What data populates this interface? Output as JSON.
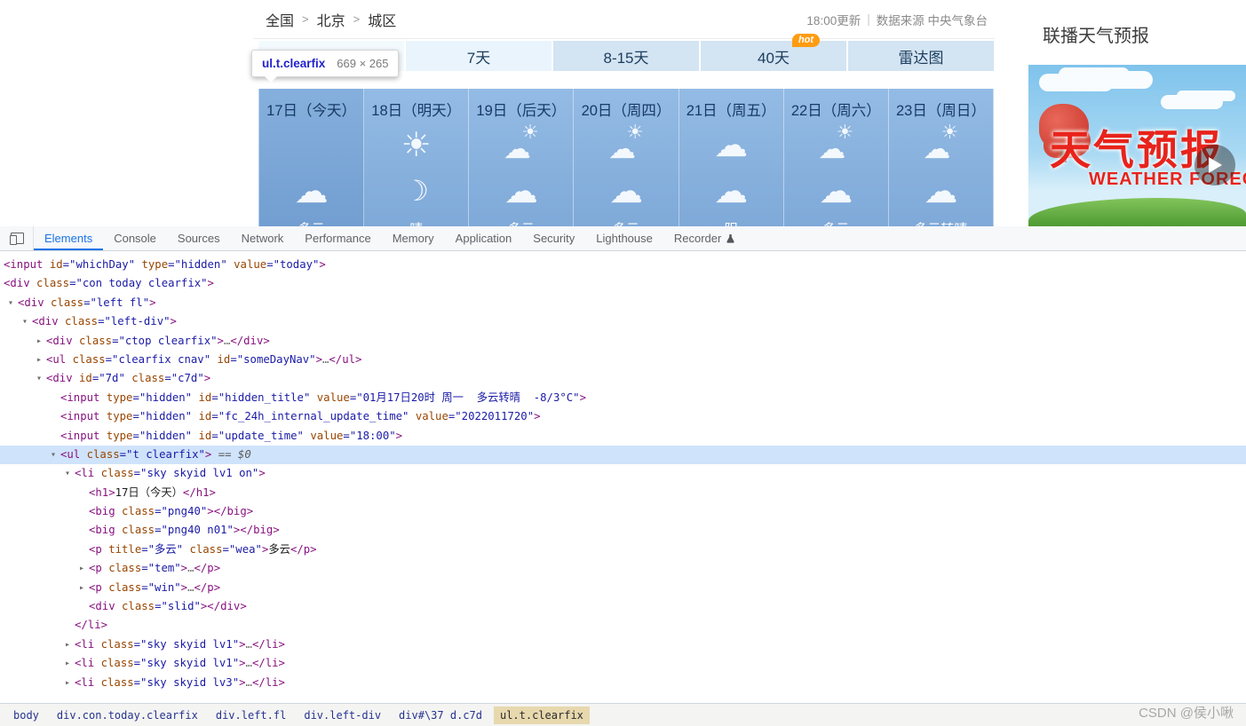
{
  "weather": {
    "site_breadcrumb": [
      "全国",
      "北京",
      "城区"
    ],
    "separator": ">",
    "update_time": "18:00更新",
    "divider": "|",
    "source": "数据来源 中央气象台",
    "tabs": [
      {
        "label": "7天",
        "variant": "light"
      },
      {
        "label": "8-15天"
      },
      {
        "label": "40天",
        "badge": "hot"
      },
      {
        "label": "雷达图"
      }
    ],
    "days": [
      {
        "title": "17日（今天）",
        "icons": [
          null,
          "cloud"
        ],
        "wea": "多云"
      },
      {
        "title": "18日（明天）",
        "icons": [
          "sun",
          "moon"
        ],
        "wea": "晴"
      },
      {
        "title": "19日（后天）",
        "icons": [
          "sun-cloud",
          "cloud"
        ],
        "wea": "多云"
      },
      {
        "title": "20日（周四）",
        "icons": [
          "sun-cloud",
          "cloud"
        ],
        "wea": "多云"
      },
      {
        "title": "21日（周五）",
        "icons": [
          "cloud",
          "cloud"
        ],
        "wea": "阴"
      },
      {
        "title": "22日（周六）",
        "icons": [
          "sun-cloud",
          "cloud"
        ],
        "wea": "多云"
      },
      {
        "title": "23日（周日）",
        "icons": [
          "sun-cloud",
          "cloud"
        ],
        "wea": "多云转晴"
      }
    ]
  },
  "inspect_tooltip": {
    "selector": "ul.t.clearfix",
    "dimensions": "669 × 265"
  },
  "video_panel": {
    "title": "联播天气预报",
    "overlay_title_cn": "天气预报",
    "overlay_title_en": "WEATHER FOREC"
  },
  "devtools": {
    "tabs": [
      {
        "label": "Elements",
        "active": true
      },
      {
        "label": "Console"
      },
      {
        "label": "Sources"
      },
      {
        "label": "Network"
      },
      {
        "label": "Performance"
      },
      {
        "label": "Memory"
      },
      {
        "label": "Application"
      },
      {
        "label": "Security"
      },
      {
        "label": "Lighthouse"
      },
      {
        "label": "Recorder",
        "icon": "flask"
      }
    ],
    "tree": [
      {
        "i": 0,
        "tok": [
          [
            "tag",
            "<input"
          ],
          [
            "pln",
            " "
          ],
          [
            "attr",
            "id"
          ],
          [
            "val",
            "=\"whichDay\""
          ],
          [
            "pln",
            " "
          ],
          [
            "attr",
            "type"
          ],
          [
            "val",
            "=\"hidden\""
          ],
          [
            "pln",
            " "
          ],
          [
            "attr",
            "value"
          ],
          [
            "val",
            "=\"today\""
          ],
          [
            "tag",
            ">"
          ]
        ]
      },
      {
        "i": 0,
        "tok": [
          [
            "tag",
            "<div"
          ],
          [
            "pln",
            " "
          ],
          [
            "attr",
            "class"
          ],
          [
            "val",
            "=\"con today clearfix\""
          ],
          [
            "tag",
            ">"
          ]
        ]
      },
      {
        "i": 1,
        "a": "d",
        "tok": [
          [
            "tag",
            "<div"
          ],
          [
            "pln",
            " "
          ],
          [
            "attr",
            "class"
          ],
          [
            "val",
            "=\"left fl\""
          ],
          [
            "tag",
            ">"
          ]
        ]
      },
      {
        "i": 2,
        "a": "d",
        "tok": [
          [
            "tag",
            "<div"
          ],
          [
            "pln",
            " "
          ],
          [
            "attr",
            "class"
          ],
          [
            "val",
            "=\"left-div\""
          ],
          [
            "tag",
            ">"
          ]
        ]
      },
      {
        "i": 3,
        "a": "r",
        "tok": [
          [
            "tag",
            "<div"
          ],
          [
            "pln",
            " "
          ],
          [
            "attr",
            "class"
          ],
          [
            "val",
            "=\"ctop clearfix\""
          ],
          [
            "tag",
            ">"
          ],
          [
            "dots",
            "…"
          ],
          [
            "tag",
            "</div>"
          ]
        ]
      },
      {
        "i": 3,
        "a": "r",
        "tok": [
          [
            "tag",
            "<ul"
          ],
          [
            "pln",
            " "
          ],
          [
            "attr",
            "class"
          ],
          [
            "val",
            "=\"clearfix cnav\""
          ],
          [
            "pln",
            " "
          ],
          [
            "attr",
            "id"
          ],
          [
            "val",
            "=\"someDayNav\""
          ],
          [
            "tag",
            ">"
          ],
          [
            "dots",
            "…"
          ],
          [
            "tag",
            "</ul>"
          ]
        ]
      },
      {
        "i": 3,
        "a": "d",
        "tok": [
          [
            "tag",
            "<div"
          ],
          [
            "pln",
            " "
          ],
          [
            "attr",
            "id"
          ],
          [
            "val",
            "=\"7d\""
          ],
          [
            "pln",
            " "
          ],
          [
            "attr",
            "class"
          ],
          [
            "val",
            "=\"c7d\""
          ],
          [
            "tag",
            ">"
          ]
        ]
      },
      {
        "i": 4,
        "tok": [
          [
            "tag",
            "<input"
          ],
          [
            "pln",
            " "
          ],
          [
            "attr",
            "type"
          ],
          [
            "val",
            "=\"hidden\""
          ],
          [
            "pln",
            " "
          ],
          [
            "attr",
            "id"
          ],
          [
            "val",
            "=\"hidden_title\""
          ],
          [
            "pln",
            " "
          ],
          [
            "attr",
            "value"
          ],
          [
            "val",
            "=\"01月17日20时 周一  多云转晴  -8/3°C\""
          ],
          [
            "tag",
            ">"
          ]
        ]
      },
      {
        "i": 4,
        "tok": [
          [
            "tag",
            "<input"
          ],
          [
            "pln",
            " "
          ],
          [
            "attr",
            "type"
          ],
          [
            "val",
            "=\"hidden\""
          ],
          [
            "pln",
            " "
          ],
          [
            "attr",
            "id"
          ],
          [
            "val",
            "=\"fc_24h_internal_update_time\""
          ],
          [
            "pln",
            " "
          ],
          [
            "attr",
            "value"
          ],
          [
            "val",
            "=\"2022011720\""
          ],
          [
            "tag",
            ">"
          ]
        ]
      },
      {
        "i": 4,
        "tok": [
          [
            "tag",
            "<input"
          ],
          [
            "pln",
            " "
          ],
          [
            "attr",
            "type"
          ],
          [
            "val",
            "=\"hidden\""
          ],
          [
            "pln",
            " "
          ],
          [
            "attr",
            "id"
          ],
          [
            "val",
            "=\"update_time\""
          ],
          [
            "pln",
            " "
          ],
          [
            "attr",
            "value"
          ],
          [
            "val",
            "=\"18:00\""
          ],
          [
            "tag",
            ">"
          ]
        ]
      },
      {
        "i": 4,
        "a": "d",
        "sel": true,
        "tok": [
          [
            "tag",
            "<ul"
          ],
          [
            "pln",
            " "
          ],
          [
            "attr",
            "class"
          ],
          [
            "val",
            "=\"t clearfix\""
          ],
          [
            "tag",
            ">"
          ],
          [
            "eq",
            " == $0"
          ]
        ]
      },
      {
        "i": 5,
        "a": "d",
        "tok": [
          [
            "tag",
            "<li"
          ],
          [
            "pln",
            " "
          ],
          [
            "attr",
            "class"
          ],
          [
            "val",
            "=\"sky skyid lv1 on\""
          ],
          [
            "tag",
            ">"
          ]
        ]
      },
      {
        "i": 6,
        "tok": [
          [
            "tag",
            "<h1>"
          ],
          [
            "txt",
            "17日（今天）"
          ],
          [
            "tag",
            "</h1>"
          ]
        ]
      },
      {
        "i": 6,
        "tok": [
          [
            "tag",
            "<big"
          ],
          [
            "pln",
            " "
          ],
          [
            "attr",
            "class"
          ],
          [
            "val",
            "=\"png40\""
          ],
          [
            "tag",
            ">"
          ],
          [
            "tag",
            "</big>"
          ]
        ]
      },
      {
        "i": 6,
        "tok": [
          [
            "tag",
            "<big"
          ],
          [
            "pln",
            " "
          ],
          [
            "attr",
            "class"
          ],
          [
            "val",
            "=\"png40 n01\""
          ],
          [
            "tag",
            ">"
          ],
          [
            "tag",
            "</big>"
          ]
        ]
      },
      {
        "i": 6,
        "tok": [
          [
            "tag",
            "<p"
          ],
          [
            "pln",
            " "
          ],
          [
            "attr",
            "title"
          ],
          [
            "val",
            "=\"多云\""
          ],
          [
            "pln",
            " "
          ],
          [
            "attr",
            "class"
          ],
          [
            "val",
            "=\"wea\""
          ],
          [
            "tag",
            ">"
          ],
          [
            "txt",
            "多云"
          ],
          [
            "tag",
            "</p>"
          ]
        ]
      },
      {
        "i": 6,
        "a": "r",
        "tok": [
          [
            "tag",
            "<p"
          ],
          [
            "pln",
            " "
          ],
          [
            "attr",
            "class"
          ],
          [
            "val",
            "=\"tem\""
          ],
          [
            "tag",
            ">"
          ],
          [
            "dots",
            "…"
          ],
          [
            "tag",
            "</p>"
          ]
        ]
      },
      {
        "i": 6,
        "a": "r",
        "tok": [
          [
            "tag",
            "<p"
          ],
          [
            "pln",
            " "
          ],
          [
            "attr",
            "class"
          ],
          [
            "val",
            "=\"win\""
          ],
          [
            "tag",
            ">"
          ],
          [
            "dots",
            "…"
          ],
          [
            "tag",
            "</p>"
          ]
        ]
      },
      {
        "i": 6,
        "tok": [
          [
            "tag",
            "<div"
          ],
          [
            "pln",
            " "
          ],
          [
            "attr",
            "class"
          ],
          [
            "val",
            "=\"slid\""
          ],
          [
            "tag",
            ">"
          ],
          [
            "tag",
            "</div>"
          ]
        ]
      },
      {
        "i": 5,
        "tok": [
          [
            "tag",
            "</li>"
          ]
        ]
      },
      {
        "i": 5,
        "a": "r",
        "tok": [
          [
            "tag",
            "<li"
          ],
          [
            "pln",
            " "
          ],
          [
            "attr",
            "class"
          ],
          [
            "val",
            "=\"sky skyid lv1\""
          ],
          [
            "tag",
            ">"
          ],
          [
            "dots",
            "…"
          ],
          [
            "tag",
            "</li>"
          ]
        ]
      },
      {
        "i": 5,
        "a": "r",
        "tok": [
          [
            "tag",
            "<li"
          ],
          [
            "pln",
            " "
          ],
          [
            "attr",
            "class"
          ],
          [
            "val",
            "=\"sky skyid lv1\""
          ],
          [
            "tag",
            ">"
          ],
          [
            "dots",
            "…"
          ],
          [
            "tag",
            "</li>"
          ]
        ]
      },
      {
        "i": 5,
        "a": "r",
        "tok": [
          [
            "tag",
            "<li"
          ],
          [
            "pln",
            " "
          ],
          [
            "attr",
            "class"
          ],
          [
            "val",
            "=\"sky skyid lv3\""
          ],
          [
            "tag",
            ">"
          ],
          [
            "dots",
            "…"
          ],
          [
            "tag",
            "</li>"
          ]
        ]
      }
    ],
    "breadcrumbs": [
      {
        "label": "body"
      },
      {
        "label": "div.con.today.clearfix"
      },
      {
        "label": "div.left.fl"
      },
      {
        "label": "div.left-div"
      },
      {
        "label": "div#\\37 d.c7d"
      },
      {
        "label": "ul.t.clearfix",
        "active": true
      }
    ]
  },
  "watermark": "CSDN @侯小啾"
}
